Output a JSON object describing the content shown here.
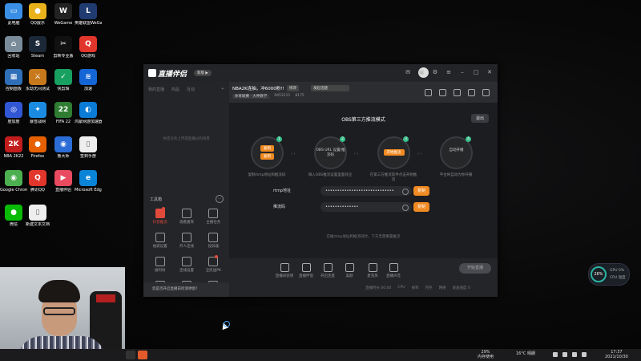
{
  "desktop": {
    "icons": [
      {
        "label": "此电脑",
        "color": "#3a8ee6",
        "glyph": "▭"
      },
      {
        "label": "QQ展示",
        "color": "#e9b21a",
        "glyph": "●"
      },
      {
        "label": "WeGame",
        "color": "#222222",
        "glyph": "W"
      },
      {
        "label": "英雄联盟WeGame版",
        "color": "#1f3b70",
        "glyph": "L"
      },
      {
        "label": "回收站",
        "color": "#7a8c99",
        "glyph": "⌂"
      },
      {
        "label": "Steam",
        "color": "#1b2838",
        "glyph": "S"
      },
      {
        "label": "剪映专业版",
        "color": "#111111",
        "glyph": "✂"
      },
      {
        "label": "QQ游戏",
        "color": "#e2362c",
        "glyph": "Q"
      },
      {
        "label": "控制面板",
        "color": "#2f6fb7",
        "glyph": "▦"
      },
      {
        "label": "永劫无间测试",
        "color": "#c8791c",
        "glyph": "⚔"
      },
      {
        "label": "快剪辑",
        "color": "#18a060",
        "glyph": "✓"
      },
      {
        "label": "加速",
        "color": "#1466d6",
        "glyph": "≋"
      },
      {
        "label": "度加度",
        "color": "#3157d6",
        "glyph": "◎"
      },
      {
        "label": "暴雪战网",
        "color": "#1a8be0",
        "glyph": "✦"
      },
      {
        "label": "FIFA 22",
        "color": "#2e7d32",
        "glyph": "22"
      },
      {
        "label": "鸿蒙网游加速器5.0",
        "color": "#0a7bd6",
        "glyph": "◐"
      },
      {
        "label": "NBA 2K22",
        "color": "#c21d1d",
        "glyph": "2K"
      },
      {
        "label": "Firefox",
        "color": "#e66000",
        "glyph": "●"
      },
      {
        "label": "鲁大师",
        "color": "#2b6cd6",
        "glyph": "◉"
      },
      {
        "label": "签到手册",
        "color": "#eeeeee",
        "glyph": "▯"
      },
      {
        "label": "Google Chrome",
        "color": "#4caf50",
        "glyph": "◉"
      },
      {
        "label": "腾讯QQ",
        "color": "#e2362c",
        "glyph": "Q"
      },
      {
        "label": "直播伴侣",
        "color": "#e84a5f",
        "glyph": "▶"
      },
      {
        "label": "Microsoft Edge",
        "color": "#0a84d6",
        "glyph": "e"
      },
      {
        "label": "微信",
        "color": "#09bb07",
        "glyph": "●"
      },
      {
        "label": "新建文本文档",
        "color": "#eeeeee",
        "glyph": "▯"
      }
    ]
  },
  "app": {
    "name": "直播伴侣",
    "version": "新版 ▶",
    "left_tabs": [
      "我的直播",
      "商品",
      "互动",
      "+"
    ],
    "empty_message": "你还没有上传或直播过的场景",
    "toolbox_title": "工具箱",
    "tools": [
      {
        "label": "抖音推流",
        "active": true,
        "badge": true
      },
      {
        "label": "观看嘉宾",
        "active": false,
        "badge": false
      },
      {
        "label": "主播任务",
        "active": false,
        "badge": false
      },
      {
        "label": "福袋设置",
        "active": false,
        "badge": false
      },
      {
        "label": "开人连线",
        "active": false,
        "badge": false
      },
      {
        "label": "投屏器",
        "active": false,
        "badge": false
      },
      {
        "label": "福利场",
        "active": false,
        "badge": false
      },
      {
        "label": "连线设置",
        "active": false,
        "badge": false
      },
      {
        "label": "全民送PK",
        "active": false,
        "badge": true
      },
      {
        "label": "",
        "active": false,
        "badge": false
      },
      {
        "label": "",
        "active": false,
        "badge": false
      },
      {
        "label": "",
        "active": false,
        "badge": false
      }
    ],
    "notice": "您是否开启直播前检测弹窗?",
    "room": {
      "title": "NBA2K连抽，冲6000粉!!",
      "edit_tag": "修改",
      "tag": "发起话题",
      "category": "体育联赛 · 大神教学",
      "number_label": "9453111",
      "followers": "8175"
    },
    "obs": {
      "title": "OBS第三方推流模式",
      "exit": "退出",
      "steps": [
        {
          "num": "1",
          "pill_a": "复制",
          "pill_b": "复制",
          "text": "",
          "desc": "复制rtmp地址和推流码"
        },
        {
          "num": "2",
          "pill_a": "",
          "pill_b": "",
          "text": "OBS URL 设置/推流码",
          "desc": "填入OBS推流设置里面对应"
        },
        {
          "num": "3",
          "pill_a": "开始推流",
          "pill_b": "",
          "text": "",
          "desc": "在第三方推流软件点击开始推流"
        },
        {
          "num": "4",
          "pill_a": "",
          "pill_b": "",
          "text": "自动开播",
          "desc": "平台将自动为你开播"
        }
      ],
      "rtmp_label": "rtmp地址",
      "rtmp_value": "•••••••••••••••••••••••••••••",
      "key_label": "推流码",
      "key_value": "••••••••••••••",
      "copy_label": "复制",
      "hint": "在推rtmp地址和推流码时，下方无需重置推流"
    },
    "bottom_tools": [
      "直播间装修",
      "直播伴侣",
      "开启连麦",
      "美颜",
      "麦克风",
      "直播声音"
    ],
    "start_button": "开始直播",
    "status_items": [
      "直播时长 00:00",
      "CPU",
      "帧率",
      "内存",
      "网络",
      "发送速度 0"
    ]
  },
  "gauge": {
    "percent": "26%",
    "line1": "GPU 0%",
    "line2": "CPU 温度"
  },
  "taskbar": {
    "memory_percent": "29%",
    "memory_label": "内存使用",
    "weather": "16°C 晴朗",
    "time": "17:37",
    "date": "2021/10/30"
  }
}
